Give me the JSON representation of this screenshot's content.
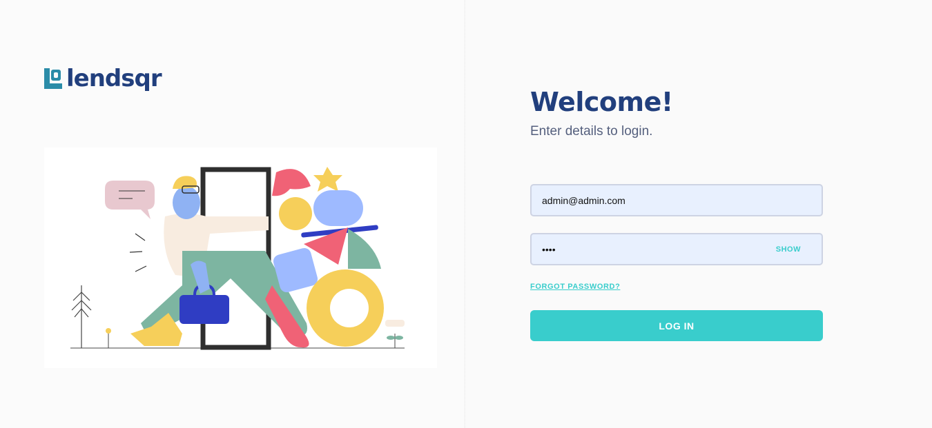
{
  "brand": {
    "name": "lendsqr"
  },
  "colors": {
    "primary": "#213f7d",
    "accent": "#39cdcc",
    "subtitle": "#545f7d",
    "field_bg": "#e8f0fe"
  },
  "login": {
    "heading": "Welcome!",
    "subheading": "Enter details to login.",
    "email": {
      "value": "admin@admin.com",
      "type": "email"
    },
    "password": {
      "value": "••••",
      "type": "password"
    },
    "show_label": "SHOW",
    "forgot_label": "FORGOT PASSWORD?",
    "submit_label": "LOG IN"
  },
  "illustration": {
    "icon": "sign-in-illustration"
  }
}
